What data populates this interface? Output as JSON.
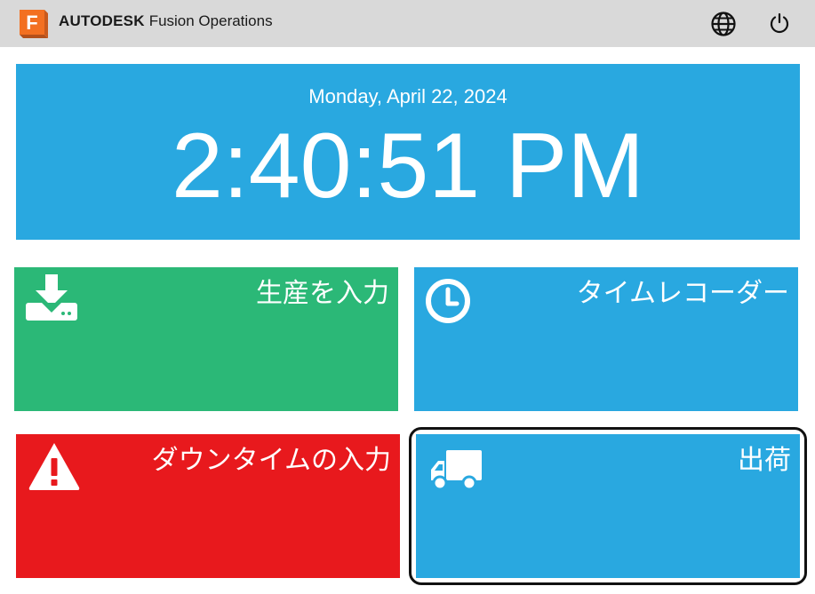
{
  "header": {
    "logo_letter": "F",
    "brand_strong": "AUTODESK",
    "brand_light": "Fusion Operations",
    "globe_icon": "globe-icon",
    "power_icon": "power-icon"
  },
  "clock": {
    "date": "Monday, April 22, 2024",
    "time": "2:40:51 PM"
  },
  "tiles": [
    {
      "label": "生産を入力",
      "icon": "download-to-drive-icon",
      "color": "#2bb877"
    },
    {
      "label": "タイムレコーダー",
      "icon": "clock-icon",
      "color": "#29a8e0"
    },
    {
      "label": "ダウンタイムの入力",
      "icon": "warning-icon",
      "color": "#e8191d"
    },
    {
      "label": "出荷",
      "icon": "truck-icon",
      "color": "#29a8e0",
      "focused": true
    }
  ],
  "colors": {
    "header_bg": "#d9d9d9",
    "clock_bg": "#29a8e0",
    "logo_orange": "#f37021"
  }
}
